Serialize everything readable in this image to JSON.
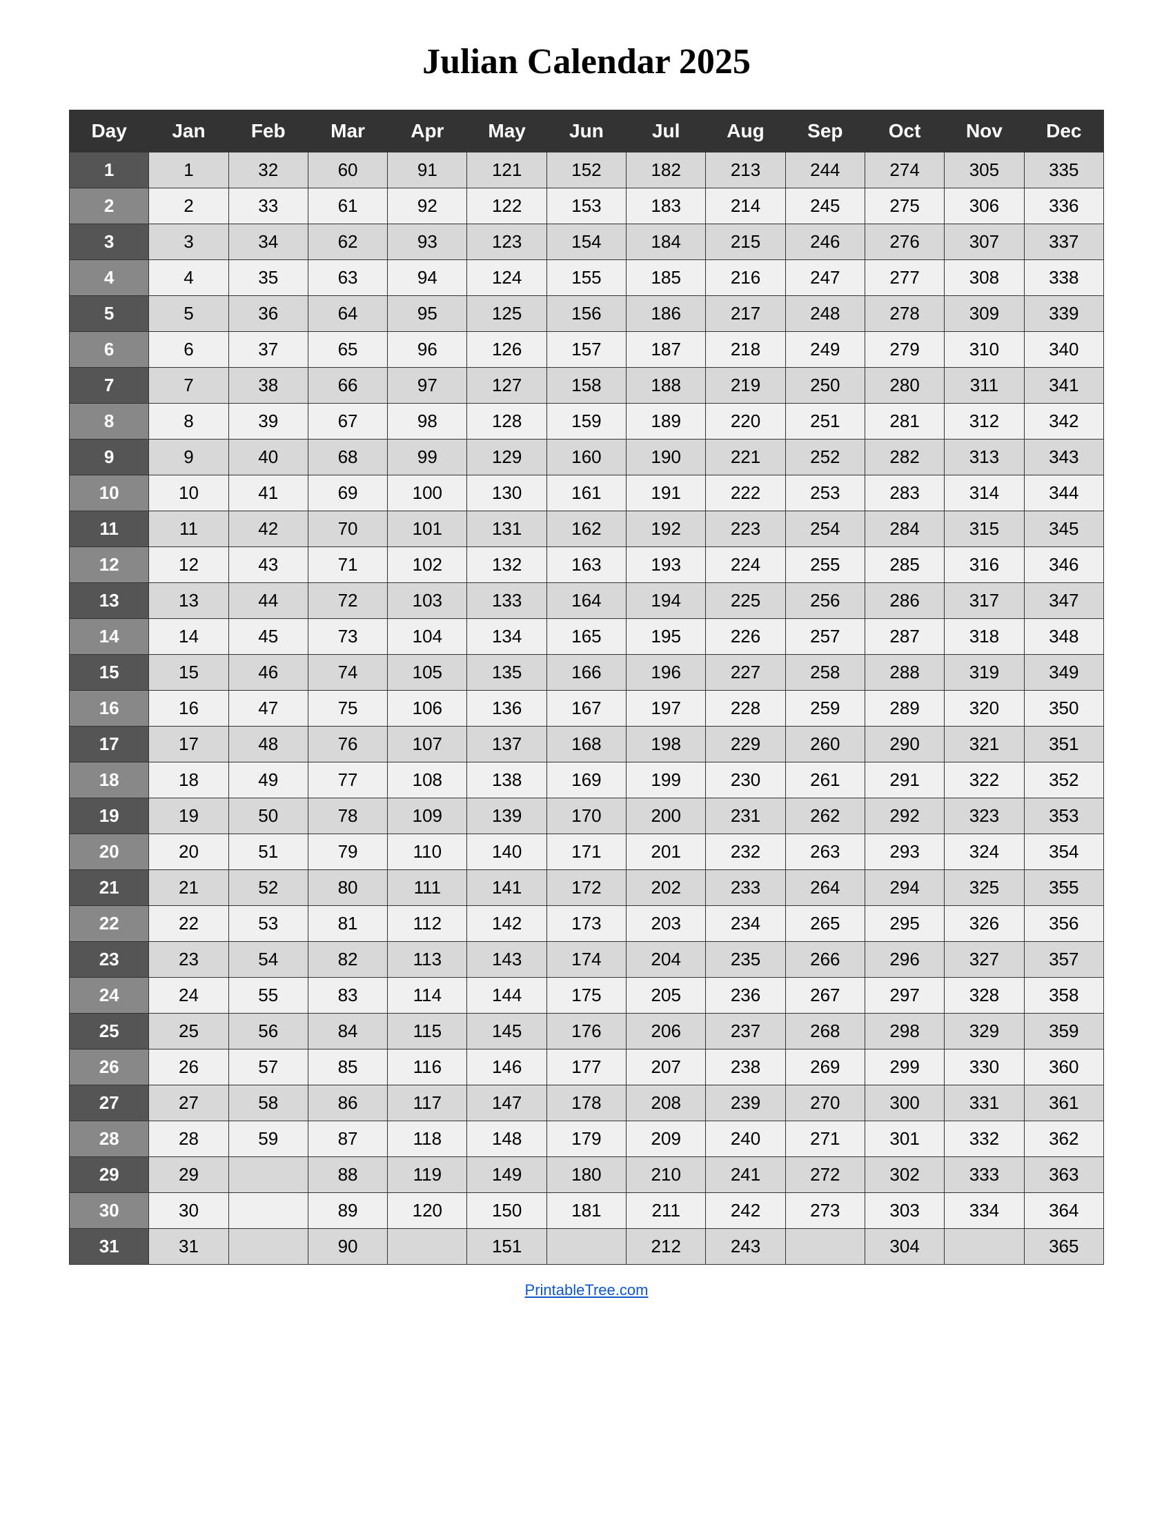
{
  "title": "Julian Calendar 2025",
  "footer": "PrintableTree.com",
  "headers": [
    "Day",
    "Jan",
    "Feb",
    "Mar",
    "Apr",
    "May",
    "Jun",
    "Jul",
    "Aug",
    "Sep",
    "Oct",
    "Nov",
    "Dec"
  ],
  "rows": [
    {
      "day": 1,
      "Jan": 1,
      "Feb": 32,
      "Mar": 60,
      "Apr": 91,
      "May": 121,
      "Jun": 152,
      "Jul": 182,
      "Aug": 213,
      "Sep": 244,
      "Oct": 274,
      "Nov": 305,
      "Dec": 335
    },
    {
      "day": 2,
      "Jan": 2,
      "Feb": 33,
      "Mar": 61,
      "Apr": 92,
      "May": 122,
      "Jun": 153,
      "Jul": 183,
      "Aug": 214,
      "Sep": 245,
      "Oct": 275,
      "Nov": 306,
      "Dec": 336
    },
    {
      "day": 3,
      "Jan": 3,
      "Feb": 34,
      "Mar": 62,
      "Apr": 93,
      "May": 123,
      "Jun": 154,
      "Jul": 184,
      "Aug": 215,
      "Sep": 246,
      "Oct": 276,
      "Nov": 307,
      "Dec": 337
    },
    {
      "day": 4,
      "Jan": 4,
      "Feb": 35,
      "Mar": 63,
      "Apr": 94,
      "May": 124,
      "Jun": 155,
      "Jul": 185,
      "Aug": 216,
      "Sep": 247,
      "Oct": 277,
      "Nov": 308,
      "Dec": 338
    },
    {
      "day": 5,
      "Jan": 5,
      "Feb": 36,
      "Mar": 64,
      "Apr": 95,
      "May": 125,
      "Jun": 156,
      "Jul": 186,
      "Aug": 217,
      "Sep": 248,
      "Oct": 278,
      "Nov": 309,
      "Dec": 339
    },
    {
      "day": 6,
      "Jan": 6,
      "Feb": 37,
      "Mar": 65,
      "Apr": 96,
      "May": 126,
      "Jun": 157,
      "Jul": 187,
      "Aug": 218,
      "Sep": 249,
      "Oct": 279,
      "Nov": 310,
      "Dec": 340
    },
    {
      "day": 7,
      "Jan": 7,
      "Feb": 38,
      "Mar": 66,
      "Apr": 97,
      "May": 127,
      "Jun": 158,
      "Jul": 188,
      "Aug": 219,
      "Sep": 250,
      "Oct": 280,
      "Nov": 311,
      "Dec": 341
    },
    {
      "day": 8,
      "Jan": 8,
      "Feb": 39,
      "Mar": 67,
      "Apr": 98,
      "May": 128,
      "Jun": 159,
      "Jul": 189,
      "Aug": 220,
      "Sep": 251,
      "Oct": 281,
      "Nov": 312,
      "Dec": 342
    },
    {
      "day": 9,
      "Jan": 9,
      "Feb": 40,
      "Mar": 68,
      "Apr": 99,
      "May": 129,
      "Jun": 160,
      "Jul": 190,
      "Aug": 221,
      "Sep": 252,
      "Oct": 282,
      "Nov": 313,
      "Dec": 343
    },
    {
      "day": 10,
      "Jan": 10,
      "Feb": 41,
      "Mar": 69,
      "Apr": 100,
      "May": 130,
      "Jun": 161,
      "Jul": 191,
      "Aug": 222,
      "Sep": 253,
      "Oct": 283,
      "Nov": 314,
      "Dec": 344
    },
    {
      "day": 11,
      "Jan": 11,
      "Feb": 42,
      "Mar": 70,
      "Apr": 101,
      "May": 131,
      "Jun": 162,
      "Jul": 192,
      "Aug": 223,
      "Sep": 254,
      "Oct": 284,
      "Nov": 315,
      "Dec": 345
    },
    {
      "day": 12,
      "Jan": 12,
      "Feb": 43,
      "Mar": 71,
      "Apr": 102,
      "May": 132,
      "Jun": 163,
      "Jul": 193,
      "Aug": 224,
      "Sep": 255,
      "Oct": 285,
      "Nov": 316,
      "Dec": 346
    },
    {
      "day": 13,
      "Jan": 13,
      "Feb": 44,
      "Mar": 72,
      "Apr": 103,
      "May": 133,
      "Jun": 164,
      "Jul": 194,
      "Aug": 225,
      "Sep": 256,
      "Oct": 286,
      "Nov": 317,
      "Dec": 347
    },
    {
      "day": 14,
      "Jan": 14,
      "Feb": 45,
      "Mar": 73,
      "Apr": 104,
      "May": 134,
      "Jun": 165,
      "Jul": 195,
      "Aug": 226,
      "Sep": 257,
      "Oct": 287,
      "Nov": 318,
      "Dec": 348
    },
    {
      "day": 15,
      "Jan": 15,
      "Feb": 46,
      "Mar": 74,
      "Apr": 105,
      "May": 135,
      "Jun": 166,
      "Jul": 196,
      "Aug": 227,
      "Sep": 258,
      "Oct": 288,
      "Nov": 319,
      "Dec": 349
    },
    {
      "day": 16,
      "Jan": 16,
      "Feb": 47,
      "Mar": 75,
      "Apr": 106,
      "May": 136,
      "Jun": 167,
      "Jul": 197,
      "Aug": 228,
      "Sep": 259,
      "Oct": 289,
      "Nov": 320,
      "Dec": 350
    },
    {
      "day": 17,
      "Jan": 17,
      "Feb": 48,
      "Mar": 76,
      "Apr": 107,
      "May": 137,
      "Jun": 168,
      "Jul": 198,
      "Aug": 229,
      "Sep": 260,
      "Oct": 290,
      "Nov": 321,
      "Dec": 351
    },
    {
      "day": 18,
      "Jan": 18,
      "Feb": 49,
      "Mar": 77,
      "Apr": 108,
      "May": 138,
      "Jun": 169,
      "Jul": 199,
      "Aug": 230,
      "Sep": 261,
      "Oct": 291,
      "Nov": 322,
      "Dec": 352
    },
    {
      "day": 19,
      "Jan": 19,
      "Feb": 50,
      "Mar": 78,
      "Apr": 109,
      "May": 139,
      "Jun": 170,
      "Jul": 200,
      "Aug": 231,
      "Sep": 262,
      "Oct": 292,
      "Nov": 323,
      "Dec": 353
    },
    {
      "day": 20,
      "Jan": 20,
      "Feb": 51,
      "Mar": 79,
      "Apr": 110,
      "May": 140,
      "Jun": 171,
      "Jul": 201,
      "Aug": 232,
      "Sep": 263,
      "Oct": 293,
      "Nov": 324,
      "Dec": 354
    },
    {
      "day": 21,
      "Jan": 21,
      "Feb": 52,
      "Mar": 80,
      "Apr": 111,
      "May": 141,
      "Jun": 172,
      "Jul": 202,
      "Aug": 233,
      "Sep": 264,
      "Oct": 294,
      "Nov": 325,
      "Dec": 355
    },
    {
      "day": 22,
      "Jan": 22,
      "Feb": 53,
      "Mar": 81,
      "Apr": 112,
      "May": 142,
      "Jun": 173,
      "Jul": 203,
      "Aug": 234,
      "Sep": 265,
      "Oct": 295,
      "Nov": 326,
      "Dec": 356
    },
    {
      "day": 23,
      "Jan": 23,
      "Feb": 54,
      "Mar": 82,
      "Apr": 113,
      "May": 143,
      "Jun": 174,
      "Jul": 204,
      "Aug": 235,
      "Sep": 266,
      "Oct": 296,
      "Nov": 327,
      "Dec": 357
    },
    {
      "day": 24,
      "Jan": 24,
      "Feb": 55,
      "Mar": 83,
      "Apr": 114,
      "May": 144,
      "Jun": 175,
      "Jul": 205,
      "Aug": 236,
      "Sep": 267,
      "Oct": 297,
      "Nov": 328,
      "Dec": 358
    },
    {
      "day": 25,
      "Jan": 25,
      "Feb": 56,
      "Mar": 84,
      "Apr": 115,
      "May": 145,
      "Jun": 176,
      "Jul": 206,
      "Aug": 237,
      "Sep": 268,
      "Oct": 298,
      "Nov": 329,
      "Dec": 359
    },
    {
      "day": 26,
      "Jan": 26,
      "Feb": 57,
      "Mar": 85,
      "Apr": 116,
      "May": 146,
      "Jun": 177,
      "Jul": 207,
      "Aug": 238,
      "Sep": 269,
      "Oct": 299,
      "Nov": 330,
      "Dec": 360
    },
    {
      "day": 27,
      "Jan": 27,
      "Feb": 58,
      "Mar": 86,
      "Apr": 117,
      "May": 147,
      "Jun": 178,
      "Jul": 208,
      "Aug": 239,
      "Sep": 270,
      "Oct": 300,
      "Nov": 331,
      "Dec": 361
    },
    {
      "day": 28,
      "Jan": 28,
      "Feb": 59,
      "Mar": 87,
      "Apr": 118,
      "May": 148,
      "Jun": 179,
      "Jul": 209,
      "Aug": 240,
      "Sep": 271,
      "Oct": 301,
      "Nov": 332,
      "Dec": 362
    },
    {
      "day": 29,
      "Jan": 29,
      "Feb": null,
      "Mar": 88,
      "Apr": 119,
      "May": 149,
      "Jun": 180,
      "Jul": 210,
      "Aug": 241,
      "Sep": 272,
      "Oct": 302,
      "Nov": 333,
      "Dec": 363
    },
    {
      "day": 30,
      "Jan": 30,
      "Feb": null,
      "Mar": 89,
      "Apr": 120,
      "May": 150,
      "Jun": 181,
      "Jul": 211,
      "Aug": 242,
      "Sep": 273,
      "Oct": 303,
      "Nov": 334,
      "Dec": 364
    },
    {
      "day": 31,
      "Jan": 31,
      "Feb": null,
      "Mar": 90,
      "Apr": null,
      "May": 151,
      "Jun": null,
      "Jul": 212,
      "Aug": 243,
      "Sep": null,
      "Oct": 304,
      "Nov": null,
      "Dec": 365
    }
  ]
}
